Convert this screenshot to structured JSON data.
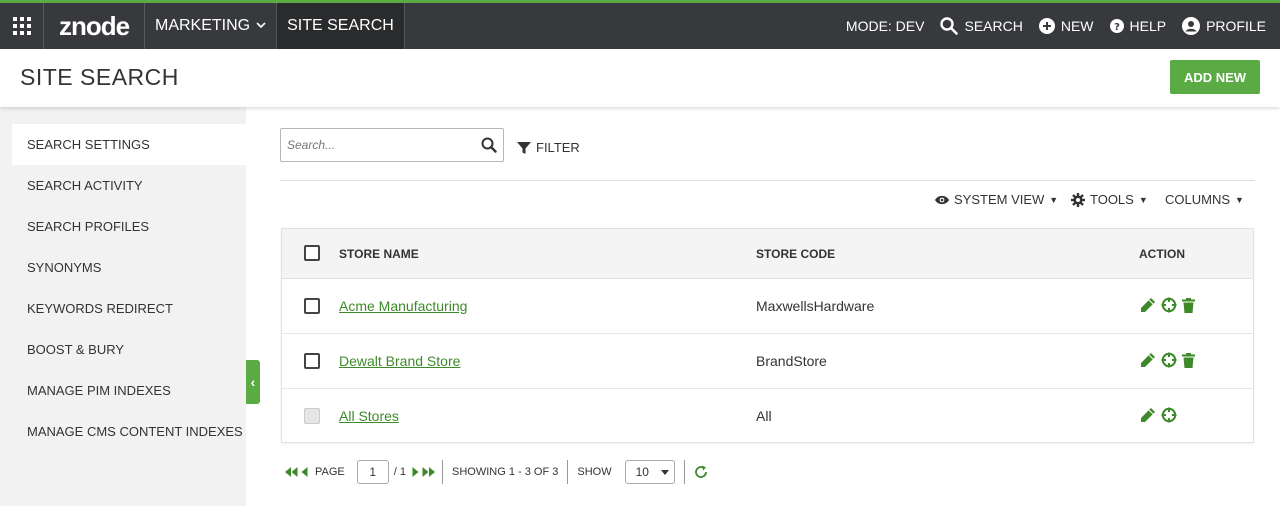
{
  "topbar": {
    "logo": "znode",
    "menus": [
      {
        "label": "MARKETING",
        "has_dropdown": true
      },
      {
        "label": "SITE SEARCH",
        "active": true
      }
    ],
    "right_items": [
      {
        "label": "MODE: DEV",
        "icon": "none"
      },
      {
        "label": "SEARCH",
        "icon": "search-icon"
      },
      {
        "label": "NEW",
        "icon": "plus-circle-icon"
      },
      {
        "label": "HELP",
        "icon": "question-circle-icon"
      },
      {
        "label": "PROFILE",
        "icon": "user-circle-icon"
      }
    ]
  },
  "page": {
    "title": "SITE SEARCH",
    "add_new_label": "ADD NEW"
  },
  "sidebar": {
    "items": [
      {
        "label": "SEARCH SETTINGS",
        "active": true
      },
      {
        "label": "SEARCH ACTIVITY"
      },
      {
        "label": "SEARCH PROFILES"
      },
      {
        "label": "SYNONYMS"
      },
      {
        "label": "KEYWORDS REDIRECT"
      },
      {
        "label": "BOOST & BURY"
      },
      {
        "label": "MANAGE PIM INDEXES"
      },
      {
        "label": "MANAGE CMS CONTENT INDEXES"
      }
    ],
    "collapse_glyph": "‹"
  },
  "toolbar": {
    "search_placeholder": "Search...",
    "filter_label": "FILTER",
    "system_view_label": "SYSTEM VIEW",
    "tools_label": "TOOLS",
    "columns_label": "COLUMNS"
  },
  "grid": {
    "columns": [
      "STORE NAME",
      "STORE CODE",
      "ACTION"
    ],
    "rows": [
      {
        "store_name": "Acme Manufacturing",
        "store_code": "MaxwellsHardware",
        "deletable": true,
        "selectable": true
      },
      {
        "store_name": "Dewalt Brand Store",
        "store_code": "BrandStore",
        "deletable": true,
        "selectable": true
      },
      {
        "store_name": "All Stores",
        "store_code": "All",
        "deletable": false,
        "selectable": false
      }
    ]
  },
  "pager": {
    "page_label": "PAGE",
    "current_page": "1",
    "total_pages_text": "/ 1",
    "showing_text": "SHOWING 1 - 3 OF 3",
    "show_label": "SHOW",
    "page_size": "10"
  },
  "colors": {
    "accent_green": "#5bab45",
    "link_green": "#3e8a2a",
    "topbar_bg": "#37393c"
  }
}
